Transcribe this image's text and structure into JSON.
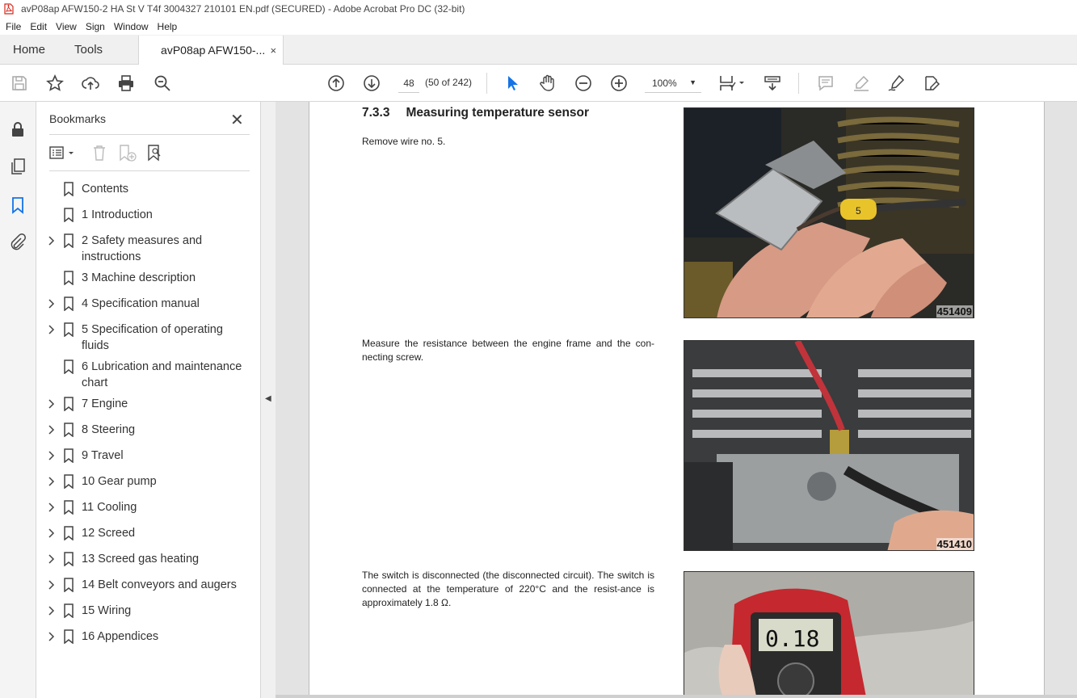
{
  "window": {
    "title": "avP08ap AFW150-2 HA St V T4f 3004327 210101 EN.pdf (SECURED) - Adobe Acrobat Pro DC (32-bit)"
  },
  "menu": [
    "File",
    "Edit",
    "View",
    "Sign",
    "Window",
    "Help"
  ],
  "tabs": {
    "home": "Home",
    "tools": "Tools",
    "document": "avP08ap AFW150-...",
    "close_glyph": "×"
  },
  "toolbar": {
    "page_number": "48",
    "page_count": "(50 of 242)",
    "zoom": "100%",
    "icons": [
      "save-icon",
      "bookmark-star-icon",
      "upload-icon",
      "print-icon",
      "zoom-search-icon",
      "page-up-icon",
      "page-down-icon",
      "select-cursor-icon",
      "hand-icon",
      "zoom-out-icon",
      "zoom-in-icon",
      "page-layout-icon",
      "scroll-mode-icon",
      "comment-icon",
      "highlight-icon",
      "sign-icon",
      "edit-icon"
    ]
  },
  "bookmarks": {
    "title": "Bookmarks",
    "items": [
      {
        "label": "Contents",
        "expandable": false
      },
      {
        "label": "1 Introduction",
        "expandable": false
      },
      {
        "label": "2 Safety measures and instructions",
        "expandable": true
      },
      {
        "label": "3 Machine description",
        "expandable": false
      },
      {
        "label": "4 Specification manual",
        "expandable": true
      },
      {
        "label": "5 Specification of operating fluids",
        "expandable": true
      },
      {
        "label": "6 Lubrication and maintenance chart",
        "expandable": false
      },
      {
        "label": "7 Engine",
        "expandable": true
      },
      {
        "label": "8 Steering",
        "expandable": true
      },
      {
        "label": "9 Travel",
        "expandable": true
      },
      {
        "label": "10 Gear pump",
        "expandable": true
      },
      {
        "label": "11 Cooling",
        "expandable": true
      },
      {
        "label": "12 Screed",
        "expandable": true
      },
      {
        "label": "13 Screed gas heating",
        "expandable": true
      },
      {
        "label": "14 Belt conveyors and augers",
        "expandable": true
      },
      {
        "label": "15 Wiring",
        "expandable": true
      },
      {
        "label": "16 Appendices",
        "expandable": true
      }
    ]
  },
  "document": {
    "section_number": "7.3.3",
    "section_title": "Measuring temperature sensor",
    "paragraphs": [
      "Remove wire no. 5.",
      "Measure the resistance between the engine frame and the con-necting screw.",
      "The switch is disconnected (the disconnected circuit). The switch is connected at the temperature of 220°C and the resist-ance is approximately 1.8 Ω."
    ],
    "photos": [
      {
        "code": "451409",
        "wire_tag": "5"
      },
      {
        "code": "451410"
      },
      {
        "code": "",
        "meter_reading": "0.18"
      }
    ]
  }
}
